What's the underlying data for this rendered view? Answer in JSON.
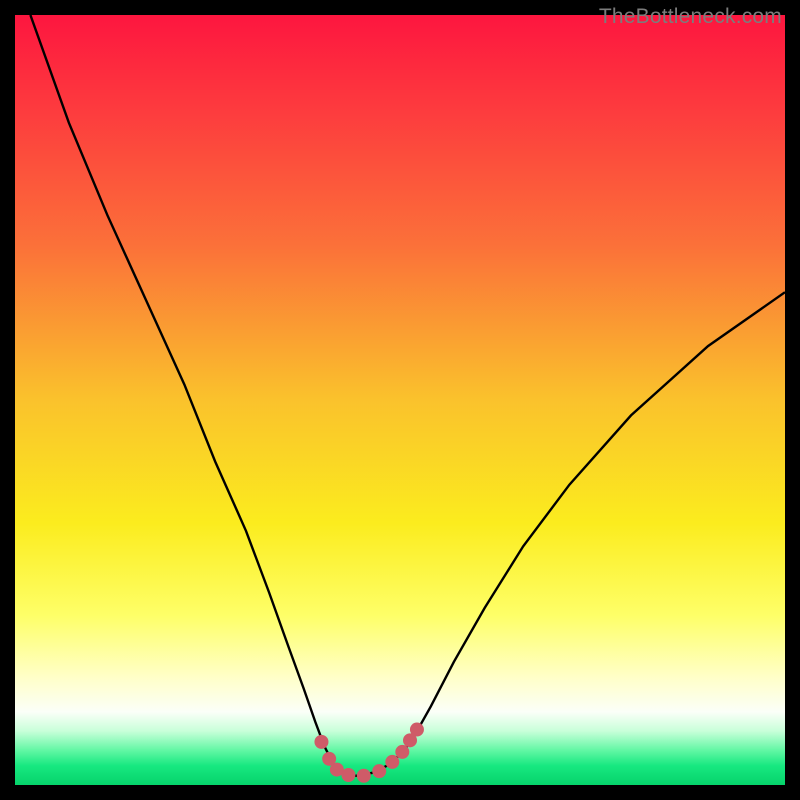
{
  "watermark": "TheBottleneck.com",
  "colors": {
    "black": "#000000",
    "curve": "#000000",
    "marker_fill": "#cf5b68",
    "watermark": "#7c7c7c",
    "gradient_stops": [
      {
        "offset": 0.0,
        "color": "#fd163f"
      },
      {
        "offset": 0.12,
        "color": "#fd3a3e"
      },
      {
        "offset": 0.3,
        "color": "#fb7139"
      },
      {
        "offset": 0.5,
        "color": "#fac22c"
      },
      {
        "offset": 0.66,
        "color": "#fbec1e"
      },
      {
        "offset": 0.78,
        "color": "#feff68"
      },
      {
        "offset": 0.86,
        "color": "#ffffc8"
      },
      {
        "offset": 0.905,
        "color": "#fbfff8"
      },
      {
        "offset": 0.93,
        "color": "#c8ffd9"
      },
      {
        "offset": 0.955,
        "color": "#62f7a4"
      },
      {
        "offset": 0.975,
        "color": "#17e880"
      },
      {
        "offset": 1.0,
        "color": "#06d36b"
      }
    ]
  },
  "chart_data": {
    "type": "line",
    "title": "",
    "xlabel": "",
    "ylabel": "",
    "xlim": [
      0,
      100
    ],
    "ylim": [
      0,
      100
    ],
    "legend": false,
    "grid": false,
    "series": [
      {
        "name": "bottleneck-curve",
        "x": [
          2,
          7,
          12,
          17,
          22,
          26,
          30,
          33,
          35.5,
          37.5,
          39,
          40.2,
          41.3,
          42.5,
          44.3,
          46.5,
          48.5,
          50.5,
          52.2,
          54,
          57,
          61,
          66,
          72,
          80,
          90,
          100
        ],
        "y": [
          100,
          86,
          74,
          63,
          52,
          42,
          33,
          25,
          18,
          12.5,
          8.2,
          5,
          2.8,
          1.5,
          1.2,
          1.6,
          2.6,
          4.4,
          7,
          10.2,
          16,
          23,
          31,
          39,
          48,
          57,
          64
        ]
      }
    ],
    "markers": {
      "name": "basin-markers",
      "x": [
        39.8,
        40.8,
        41.8,
        43.3,
        45.3,
        47.3,
        49.0,
        50.3,
        51.3,
        52.2
      ],
      "y": [
        5.6,
        3.4,
        2.0,
        1.3,
        1.2,
        1.8,
        3.0,
        4.3,
        5.8,
        7.2
      ],
      "r": 7
    }
  }
}
